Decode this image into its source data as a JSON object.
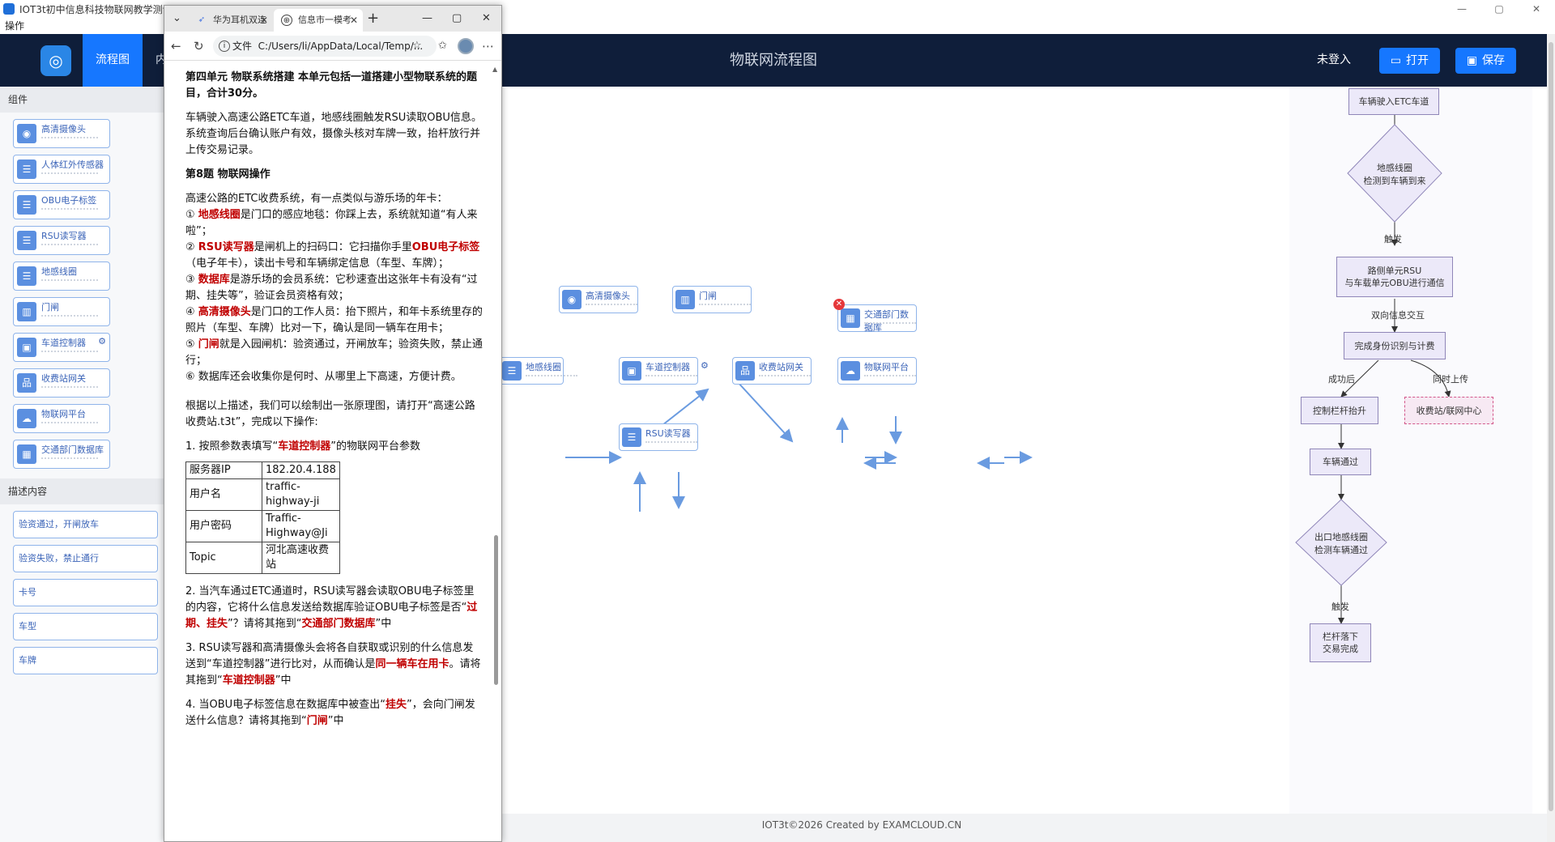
{
  "os": {
    "title": "IOT3t初中信息科技物联网教学测评v1.2",
    "menu": "操作",
    "controls": [
      "—",
      "▢",
      "✕"
    ]
  },
  "header": {
    "nav": [
      "流程图",
      "内容展示"
    ],
    "title": "物联网流程图",
    "login": "未登入",
    "open_btn": "打开",
    "save_btn": "保存"
  },
  "sidebar": {
    "components_title": "组件",
    "components": [
      {
        "label": "高清摄像头",
        "icon": "camera-icon",
        "glyph": "◉"
      },
      {
        "label": "人体红外传感器",
        "icon": "sensor-icon",
        "glyph": "☰"
      },
      {
        "label": "OBU电子标签",
        "icon": "tag-icon",
        "glyph": "☰"
      },
      {
        "label": "RSU读写器",
        "icon": "reader-icon",
        "glyph": "☰"
      },
      {
        "label": "地感线圈",
        "icon": "coil-icon",
        "glyph": "☰"
      },
      {
        "label": "门闸",
        "icon": "gate-icon",
        "glyph": "▥"
      },
      {
        "label": "车道控制器",
        "icon": "controller-icon",
        "glyph": "▣"
      },
      {
        "label": "收费站网关",
        "icon": "gateway-icon",
        "glyph": "品"
      },
      {
        "label": "物联网平台",
        "icon": "cloud-icon",
        "glyph": "☁"
      },
      {
        "label": "交通部门数据库",
        "icon": "database-icon",
        "glyph": "▦"
      }
    ],
    "desc_title": "描述内容",
    "descs": [
      "验资通过，开闸放车",
      "验资失败，禁止通行",
      "卡号",
      "车型",
      "车牌"
    ]
  },
  "canvas_nodes": [
    {
      "label": "高清摄像头",
      "glyph": "◉"
    },
    {
      "label": "门闸",
      "glyph": "▥"
    },
    {
      "label": "交通部门数据库",
      "glyph": "▦"
    },
    {
      "label": "地感线圈",
      "glyph": "☰"
    },
    {
      "label": "车道控制器",
      "glyph": "▣"
    },
    {
      "label": "收费站网关",
      "glyph": "品"
    },
    {
      "label": "物联网平台",
      "glyph": "☁"
    },
    {
      "label": "RSU读写器",
      "glyph": "☰"
    }
  ],
  "flowchart": {
    "boxes": [
      "车辆驶入ETC车道",
      "地感线圈\n检测到车辆到来",
      "路侧单元RSU\n与车载单元OBU进行通信",
      "完成身份识别与计费",
      "控制栏杆抬升",
      "收费站/联网中心",
      "车辆通过",
      "出口地感线圈\n检测车辆通过",
      "栏杆落下\n交易完成"
    ],
    "labels": [
      "触发",
      "双向信息交互",
      "成功后",
      "同时上传",
      "触发"
    ]
  },
  "footer": "IOT3t©2026 Created by EXAMCLOUD.CN",
  "browser": {
    "tab1": "华为耳机双连",
    "tab2": "信息市一模考",
    "url_prefix": "文件",
    "url": "C:/Users/li/AppData/Local/Temp/...",
    "unit_title": "第四单元 物联系统搭建  本单元包括一道搭建小型物联系统的题目，合计30分。",
    "intro": "车辆驶入高速公路ETC车道，地感线圈触发RSU读取OBU信息。系统查询后台确认账户有效，摄像头核对车牌一致，抬杆放行并上传交易记录。",
    "q_title": "第8题 物联网操作",
    "analogy": "高速公路的ETC收费系统，有一点类似与游乐场的年卡：",
    "p1a": "① ",
    "p1b": "地感线圈",
    "p1c": "是门口的感应地毯：你踩上去，系统就知道“有人来啦”；",
    "p2a": "② ",
    "p2b": "RSU读写器",
    "p2c": "是闸机上的扫码口：它扫描你手里",
    "p2d": "OBU电子标签",
    "p2e": "（电子年卡），读出卡号和车辆绑定信息（车型、车牌）；",
    "p3a": "③ ",
    "p3b": "数据库",
    "p3c": "是游乐场的会员系统：它秒速查出这张年卡有没有“过期、挂失等”，验证会员资格有效；",
    "p4a": "④ ",
    "p4b": "高清摄像头",
    "p4c": "是门口的工作人员：抬下照片，和年卡系统里存的照片（车型、车牌）比对一下，确认是同一辆车在用卡；",
    "p5a": "⑤ ",
    "p5b": "门闸",
    "p5c": "就是入园闸机：验资通过，开闸放车；验资失败，禁止通行；",
    "p6": "⑥ 数据库还会收集你是何时、从哪里上下高速，方便计费。",
    "task": "根据以上描述，我们可以绘制出一张原理图，请打开“高速公路收费站.t3t”，完成以下操作:",
    "s1a": "1. 按照参数表填写“",
    "s1b": "车道控制器",
    "s1c": "”的物联网平台参数",
    "table": [
      [
        "服务器IP",
        "182.20.4.188"
      ],
      [
        "用户名",
        "traffic-highway-ji"
      ],
      [
        "用户密码",
        "Traffic-Highway@Ji"
      ],
      [
        "Topic",
        "河北高速收费站"
      ]
    ],
    "s2a": "2. 当汽车通过ETC通道时，RSU读写器会读取OBU电子标签里的内容，它将什么信息发送给数据库验证OBU电子标签是否“",
    "s2b": "过期、挂失",
    "s2c": "”？请将其拖到“",
    "s2d": "交通部门数据库",
    "s2e": "”中",
    "s3a": "3. RSU读写器和高清摄像头会将各自获取或识别的什么信息发送到“车道控制器”进行比对，从而确认是",
    "s3b": "同一辆车在用卡",
    "s3c": "。请将其拖到“",
    "s3d": "车道控制器",
    "s3e": "”中",
    "s4a": "4. 当OBU电子标签信息在数据库中被查出“",
    "s4b": "挂失",
    "s4c": "”，会向门闸发送什么信息？请将其拖到“",
    "s4d": "门闸",
    "s4e": "”中"
  },
  "colors": {
    "header_bg": "#0f1e3a",
    "accent": "#1677ff",
    "node_border": "#8fb4ea",
    "emphasis": "#c00000"
  }
}
